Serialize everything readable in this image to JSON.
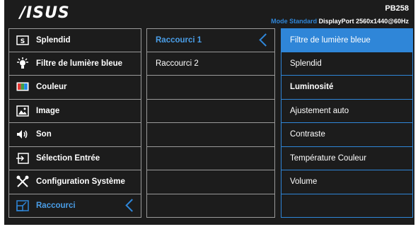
{
  "header": {
    "brand": "/ISUS",
    "model": "PB258",
    "status_mode": "Mode Standard",
    "status_port": "DisplayPort",
    "status_resolution": "2560x1440@60Hz"
  },
  "menu": [
    {
      "label": "Splendid",
      "icon": "splendid-icon"
    },
    {
      "label": "Filtre de lumière bleue",
      "icon": "blue-light-icon"
    },
    {
      "label": "Couleur",
      "icon": "color-icon"
    },
    {
      "label": "Image",
      "icon": "image-icon"
    },
    {
      "label": "Son",
      "icon": "speaker-icon"
    },
    {
      "label": "Sélection Entrée",
      "icon": "input-icon"
    },
    {
      "label": "Configuration Système",
      "icon": "wrench-icon"
    },
    {
      "label": "Raccourci",
      "icon": "shortcut-icon"
    }
  ],
  "submenu": [
    {
      "label": "Raccourci 1"
    },
    {
      "label": "Raccourci 2"
    },
    {
      "label": ""
    },
    {
      "label": ""
    },
    {
      "label": ""
    },
    {
      "label": ""
    },
    {
      "label": ""
    },
    {
      "label": ""
    }
  ],
  "options": [
    {
      "label": "Filtre de lumière bleue"
    },
    {
      "label": "Splendid"
    },
    {
      "label": "Luminosité"
    },
    {
      "label": "Ajustement auto"
    },
    {
      "label": "Contraste"
    },
    {
      "label": "Température Couleur"
    },
    {
      "label": "Volume"
    },
    {
      "label": ""
    }
  ],
  "colors": {
    "accent": "#2f86d8",
    "panel": "#1c1c1c",
    "border": "#9a9a9a"
  }
}
